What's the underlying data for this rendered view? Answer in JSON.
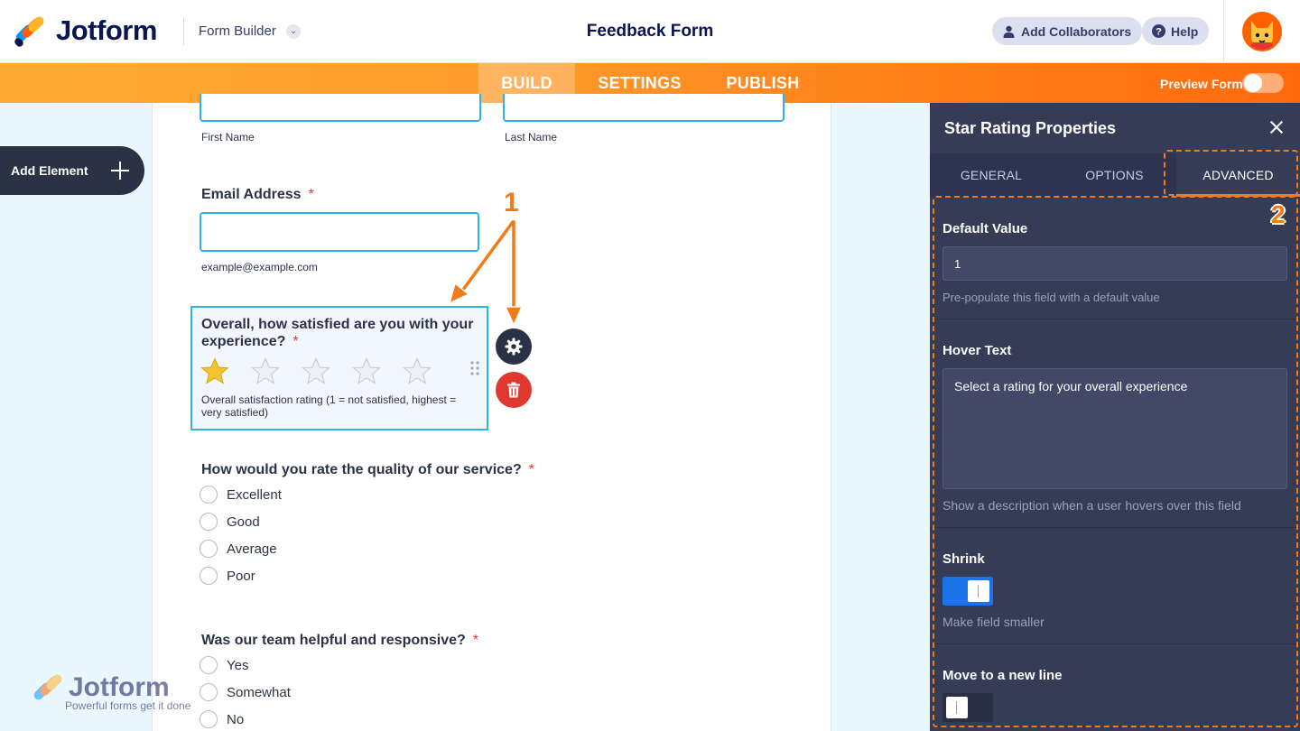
{
  "header": {
    "logo_text": "Jotform",
    "builder_label": "Form Builder",
    "form_title": "Feedback Form",
    "add_collaborators": "Add Collaborators",
    "help": "Help"
  },
  "nav": {
    "tabs": [
      "BUILD",
      "SETTINGS",
      "PUBLISH"
    ],
    "active_tab": "BUILD",
    "preview_label": "Preview Form",
    "preview_on": false
  },
  "sidebar": {
    "add_element": "Add Element"
  },
  "form": {
    "first_name_label": "First Name",
    "last_name_label": "Last Name",
    "email": {
      "label": "Email Address",
      "required_mark": "*",
      "help": "example@example.com"
    },
    "rating": {
      "label": "Overall, how satisfied are you with your experience?",
      "required_mark": "*",
      "stars_total": 5,
      "stars_filled": 1,
      "help": "Overall satisfaction rating (1 = not satisfied, highest = very satisfied)"
    },
    "service_quality": {
      "label": "How would you rate the quality of our service?",
      "required_mark": "*",
      "options": [
        "Excellent",
        "Good",
        "Average",
        "Poor"
      ]
    },
    "team_helpful": {
      "label": "Was our team helpful and responsive?",
      "required_mark": "*",
      "options": [
        "Yes",
        "Somewhat",
        "No"
      ]
    }
  },
  "annotations": {
    "marker_1": "1",
    "marker_2": "2"
  },
  "watermark": {
    "brand": "Jotform",
    "tagline": "Powerful forms get it done"
  },
  "panel": {
    "title": "Star Rating Properties",
    "tabs": [
      "GENERAL",
      "OPTIONS",
      "ADVANCED"
    ],
    "active_tab": "ADVANCED",
    "default_value": {
      "label": "Default Value",
      "value": "1",
      "help": "Pre-populate this field with a default value"
    },
    "hover_text": {
      "label": "Hover Text",
      "value": "Select a rating for your overall experience",
      "help": "Show a description when a user hovers over this field"
    },
    "shrink": {
      "label": "Shrink",
      "on": true,
      "help": "Make field smaller"
    },
    "new_line": {
      "label": "Move to a new line",
      "on": false
    }
  },
  "colors": {
    "brand_navy": "#0a1551",
    "accent_orange": "#ff7b1c",
    "focus_blue": "#2fb2e6",
    "toggle_on": "#1a73e8",
    "panel_bg": "#363c56",
    "delete_red": "#e0372e",
    "star_gold": "#f4c430"
  }
}
